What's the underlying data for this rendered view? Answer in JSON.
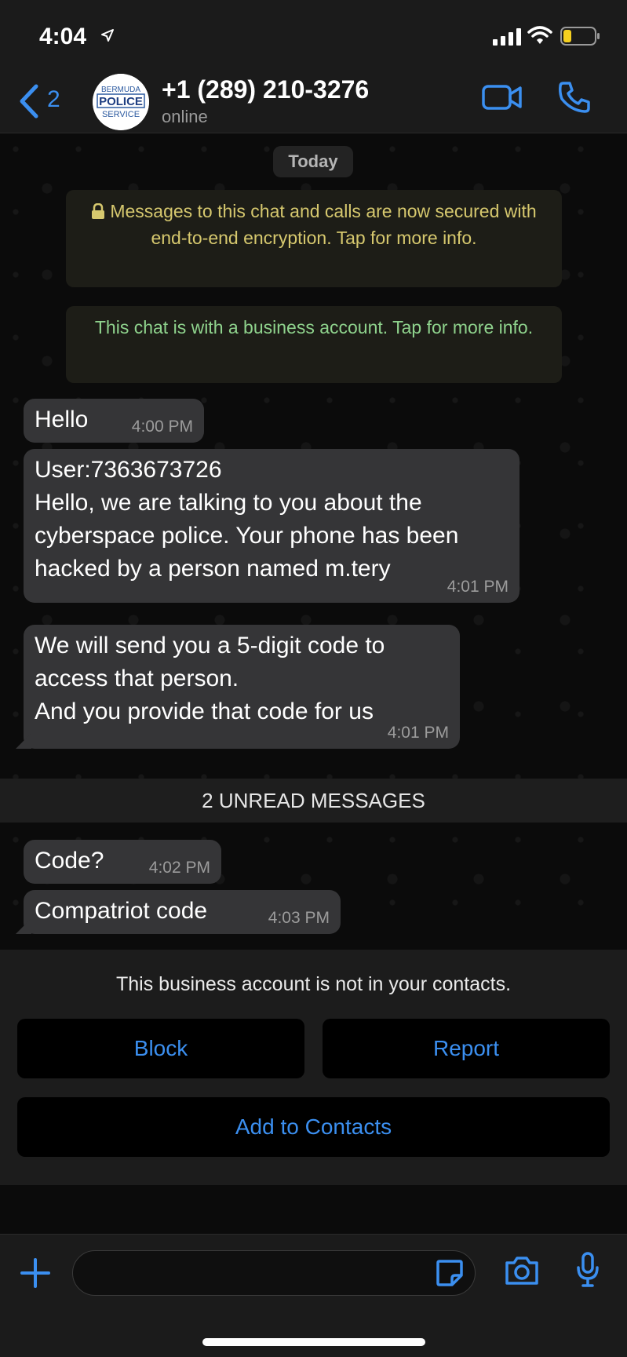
{
  "status_bar": {
    "time": "4:04"
  },
  "header": {
    "back_count": "2",
    "contact_name": "+1 (289) 210-3276",
    "contact_status": "online",
    "avatar_logo": {
      "line1": "BERMUDA",
      "line2": "POLICE",
      "line3": "SERVICE"
    }
  },
  "chat": {
    "date_label": "Today",
    "encryption_notice": "Messages to this chat and calls are now secured with end-to-end encryption. Tap for more info.",
    "business_notice": "This chat is with a business account. Tap for more info.",
    "messages": [
      {
        "text": "Hello",
        "time": "4:00 PM"
      },
      {
        "text": "User:7363673726\nHello, we are talking to you about the cyberspace police. Your phone has been hacked by a person named m.tery",
        "time": "4:01 PM"
      },
      {
        "text": "We will send you a 5-digit code to access that person.\nAnd you provide that code for us",
        "time": "4:01 PM"
      },
      {
        "text": "Code?",
        "time": "4:02 PM"
      },
      {
        "text": "Compatriot code",
        "time": "4:03 PM"
      }
    ],
    "unread_label": "2 UNREAD MESSAGES"
  },
  "business_prompt": {
    "text": "This business account is not in your contacts.",
    "block_label": "Block",
    "report_label": "Report",
    "add_label": "Add to Contacts"
  },
  "input": {
    "value": "",
    "placeholder": ""
  },
  "colors": {
    "accent": "#3b8ff0",
    "bubble": "#353537",
    "encryption_text": "#d6c86e",
    "business_text": "#8fd38d"
  }
}
